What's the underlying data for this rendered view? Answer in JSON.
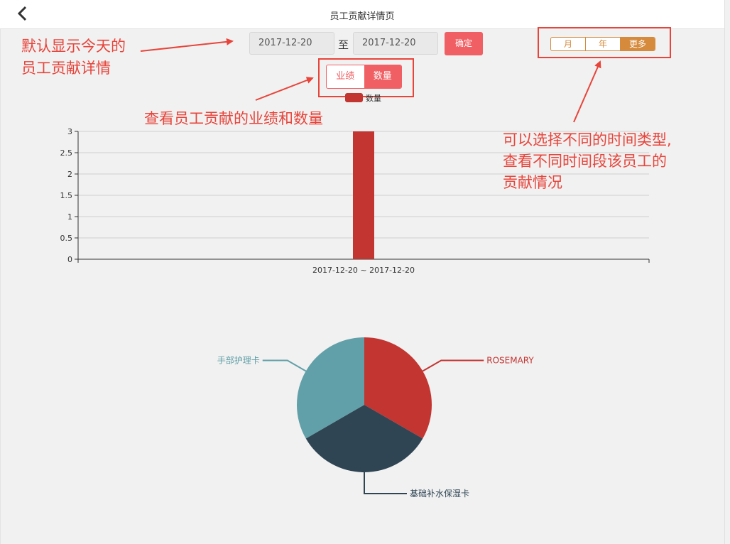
{
  "header": {
    "title": "员工贡献详情页"
  },
  "filters": {
    "start_date": "2017-12-20",
    "end_date": "2017-12-20",
    "to_label": "至",
    "confirm_label": "确定"
  },
  "time_tabs": [
    {
      "label": "月",
      "active": false
    },
    {
      "label": "年",
      "active": false
    },
    {
      "label": "更多",
      "active": true
    }
  ],
  "metric_tabs": [
    {
      "label": "业绩",
      "active": false
    },
    {
      "label": "数量",
      "active": true
    }
  ],
  "annotations": {
    "default_today": [
      "默认显示今天的",
      "员工贡献详情"
    ],
    "view_metric": "查看员工贡献的业绩和数量",
    "time_type": [
      "可以选择不同的时间类型,",
      "查看不同时间段该员工的",
      "贡献情况"
    ]
  },
  "colors": {
    "accent": "#f05f63",
    "time_tab": "#d58a3c",
    "bar": "#c23531",
    "annotation": "#e8443a"
  },
  "chart_data": [
    {
      "type": "bar",
      "legend": [
        "数量"
      ],
      "legend_placement": "top-center",
      "categories": [
        "2017-12-20 ~ 2017-12-20"
      ],
      "series": [
        {
          "name": "数量",
          "values": [
            3
          ]
        }
      ],
      "ylim": [
        0,
        3
      ],
      "yticks": [
        "0",
        "0.5",
        "1",
        "1.5",
        "2",
        "2.5",
        "3"
      ],
      "grid": true
    },
    {
      "type": "pie",
      "slices": [
        {
          "label": "ROSEMARY",
          "value": 1,
          "color": "#c23531"
        },
        {
          "label": "基础补水保湿卡",
          "value": 1,
          "color": "#2f4554"
        },
        {
          "label": "手部护理卡",
          "value": 1,
          "color": "#61a0a8"
        }
      ]
    }
  ]
}
